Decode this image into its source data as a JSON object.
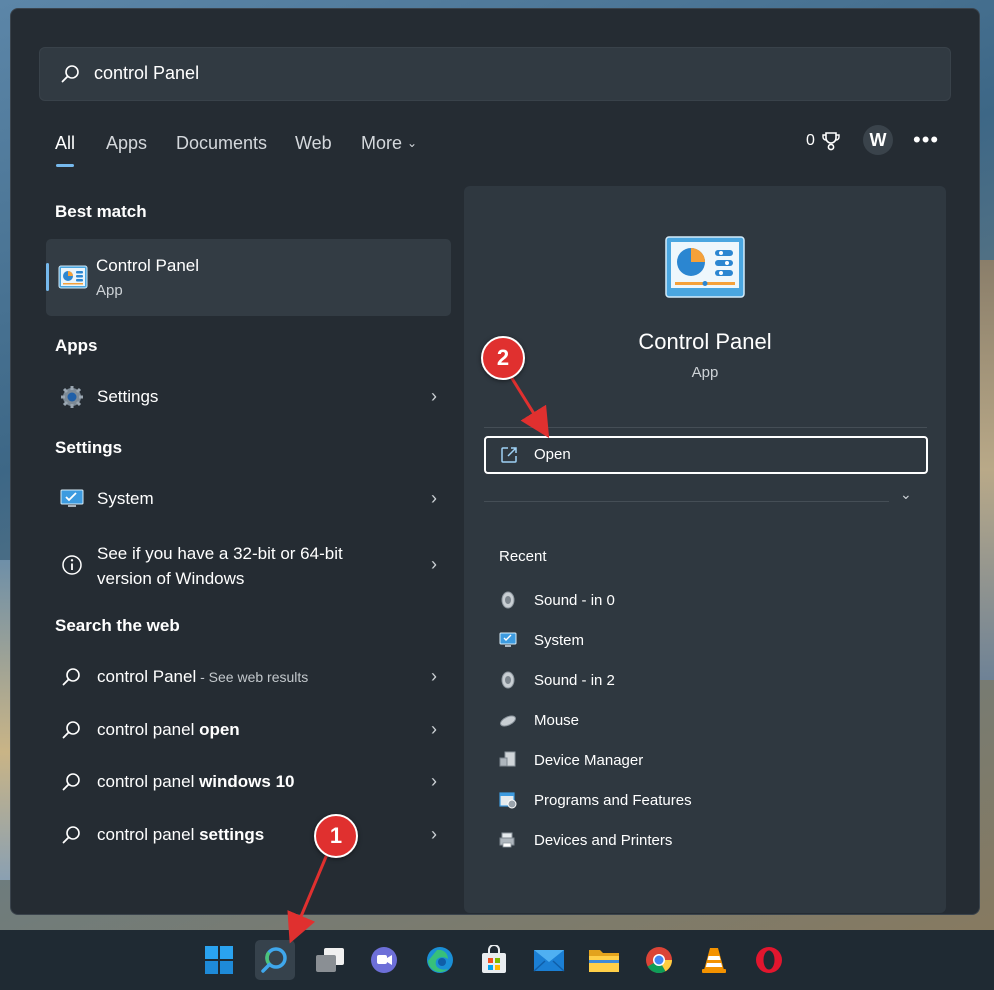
{
  "search": {
    "query": "control Panel"
  },
  "tabs": [
    {
      "label": "All"
    },
    {
      "label": "Apps"
    },
    {
      "label": "Documents"
    },
    {
      "label": "Web"
    },
    {
      "label": "More"
    }
  ],
  "header": {
    "reward_points": "0",
    "avatar_initial": "W",
    "more_icon": "ellipsis-icon"
  },
  "left": {
    "best_match_title": "Best match",
    "best_match": {
      "name": "Control Panel",
      "type": "App"
    },
    "apps_title": "Apps",
    "apps": [
      {
        "label": "Settings"
      }
    ],
    "settings_title": "Settings",
    "settings": [
      {
        "label": "System"
      },
      {
        "label": "See if you have a 32-bit or 64-bit version of Windows"
      }
    ],
    "web_title": "Search the web",
    "web": [
      {
        "prefix": "control Panel",
        "bold": "",
        "hint": " - See web results"
      },
      {
        "prefix": "control panel ",
        "bold": "open",
        "hint": ""
      },
      {
        "prefix": "control panel ",
        "bold": "windows 10",
        "hint": ""
      },
      {
        "prefix": "control panel ",
        "bold": "settings",
        "hint": ""
      }
    ]
  },
  "right": {
    "title": "Control Panel",
    "type": "App",
    "open_label": "Open",
    "recent_title": "Recent",
    "recent": [
      {
        "label": "Sound - in 0"
      },
      {
        "label": "System"
      },
      {
        "label": "Sound - in 2"
      },
      {
        "label": "Mouse"
      },
      {
        "label": "Device Manager"
      },
      {
        "label": "Programs and Features"
      },
      {
        "label": "Devices and Printers"
      }
    ]
  },
  "annotations": {
    "marker1": "1",
    "marker2": "2"
  },
  "colors": {
    "accent": "#76b9ed",
    "marker": "#e0302f",
    "panel": "#252c33"
  }
}
